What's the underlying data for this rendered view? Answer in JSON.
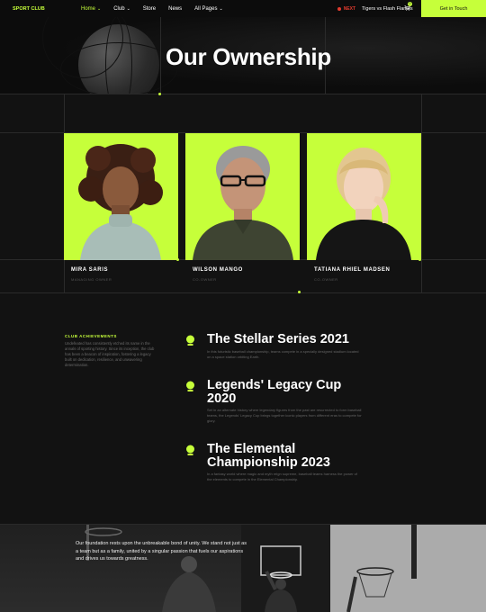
{
  "nav": {
    "logo": "SPORT CLUB",
    "items": [
      {
        "label": "Home",
        "has_dropdown": true,
        "active": true
      },
      {
        "label": "Club",
        "has_dropdown": true
      },
      {
        "label": "Store",
        "has_dropdown": false
      },
      {
        "label": "News",
        "has_dropdown": false
      },
      {
        "label": "All Pages",
        "has_dropdown": true
      }
    ],
    "next_label": "NEXT",
    "next_match": "Tigers vs Flash Flames",
    "cart_count": "0",
    "cta_label": "Get in Touch"
  },
  "hero": {
    "title": "Our Ownership"
  },
  "owners": [
    {
      "name": "MIRA SARIS",
      "role": "MANAGING OWNER"
    },
    {
      "name": "WILSON MANGO",
      "role": "CO-OWNER"
    },
    {
      "name": "TATIANA RHIEL MADSEN",
      "role": "CO-OWNER"
    }
  ],
  "achievements": {
    "kicker": "CLUB ACHIEVEMENTS",
    "intro": "Undefeated has consistently etched its name in the annals of sporting history. Since its inception, the club has been a beacon of inspiration, fostering a legacy built on dedication, resilience, and unwavering determination.",
    "items": [
      {
        "title_line1": "The Stellar Series 2021",
        "title_line2": "",
        "desc": "In this futuristic baseball championship, teams compete in a specially designed stadium located on a space station orbiting Earth."
      },
      {
        "title_line1": "Legends' Legacy Cup",
        "title_line2": "2020",
        "desc": "Set in an alternate history where legendary figures from the past are resurrected to form baseball teams, the Legends' Legacy Cup brings together iconic players from different eras to compete for glory."
      },
      {
        "title_line1": "The Elemental",
        "title_line2": "Championship 2023",
        "desc": "In a fantasy world where magic and myth reign supreme, baseball teams harness the power of the elements to compete in the Elemental Championship."
      }
    ]
  },
  "bottom": {
    "text": "Our foundation rests upon the unbreakable bond of unity. We stand not just as a team but as a family, united by a singular passion that fuels our aspirations and drives us towards greatness."
  },
  "colors": {
    "accent": "#c6ff3a",
    "background": "#121212",
    "next_red": "#e23b2e"
  }
}
